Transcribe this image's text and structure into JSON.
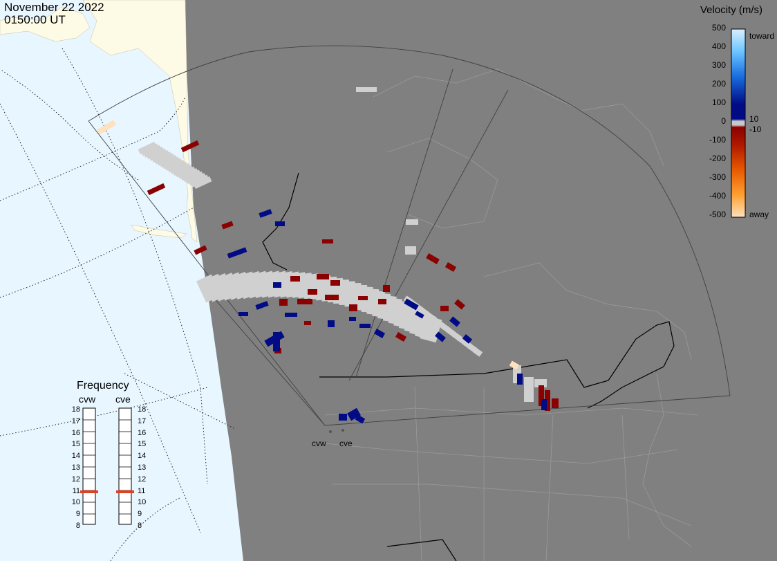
{
  "header": {
    "date": "November 22 2022",
    "time": "0150:00 UT"
  },
  "colorbar": {
    "title": "Velocity (m/s)",
    "ticks": [
      "500",
      "400",
      "300",
      "200",
      "100",
      "0",
      "-100",
      "-200",
      "-300",
      "-400",
      "-500"
    ],
    "tag_toward": "toward",
    "tag_pos10": "10",
    "tag_neg10": "-10",
    "tag_away": "away",
    "colors": {
      "toward": "#d9efff",
      "blue": "#1a6fe0",
      "navy": "#000b85",
      "zero": "#c8c8c8",
      "darkred": "#8b0000",
      "orange": "#ff8c00",
      "away": "#ffe1bf"
    }
  },
  "frequency": {
    "title": "Frequency",
    "radars": [
      {
        "name": "cvw",
        "value_mhz": 10.8
      },
      {
        "name": "cve",
        "value_mhz": 10.8
      }
    ],
    "scale": [
      "18",
      "17",
      "16",
      "15",
      "14",
      "13",
      "12",
      "11",
      "10",
      "9",
      "8"
    ]
  },
  "radar_labels": [
    "cvw",
    "cve"
  ],
  "map_colors": {
    "land": "#808080",
    "ocean": "#e8f6ff",
    "daylight_land": "#fdfbe6",
    "ground_scatter": "#d0d0d0",
    "fov_line": "#404040"
  }
}
